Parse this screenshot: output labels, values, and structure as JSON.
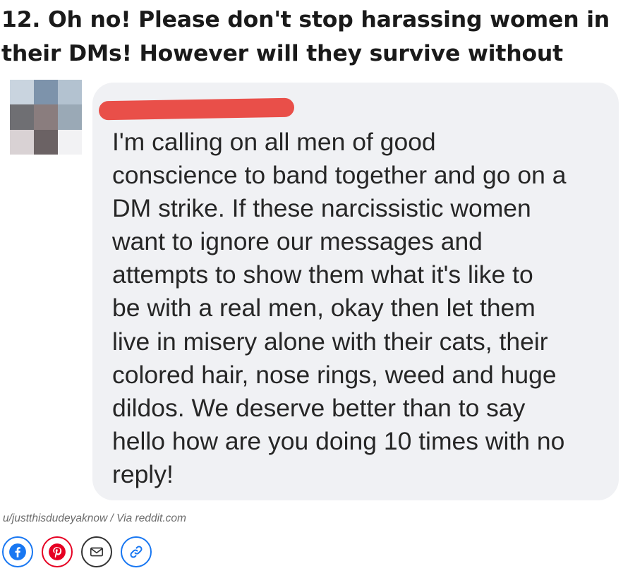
{
  "headline": "12. Oh no! Please don't stop harassing women in their DMs! However will they survive without you?!",
  "post": {
    "text": "I'm calling on all men of good\nconscience to band together and go on a\nDM strike. If these narcissistic women\nwant to ignore our messages and\nattempts to show them what it's like to\nbe with a real men, okay then let them\nlive in misery alone with their cats, their\ncolored hair, nose rings, weed and huge\ndildos. We deserve better than to say\nhello how are you doing 10 times with no\nreply!"
  },
  "credit": "u/justthisdudeyaknow / Via reddit.com",
  "share": {
    "buttons": [
      {
        "name": "facebook",
        "icon": "facebook-icon",
        "color": "#1877f2"
      },
      {
        "name": "pinterest",
        "icon": "pinterest-icon",
        "color": "#e60023"
      },
      {
        "name": "email",
        "icon": "email-icon",
        "color": "#333333"
      },
      {
        "name": "link",
        "icon": "link-icon",
        "color": "#1877f2"
      }
    ]
  },
  "colors": {
    "bubble": "#f0f1f4",
    "redaction": "#e8463f"
  }
}
